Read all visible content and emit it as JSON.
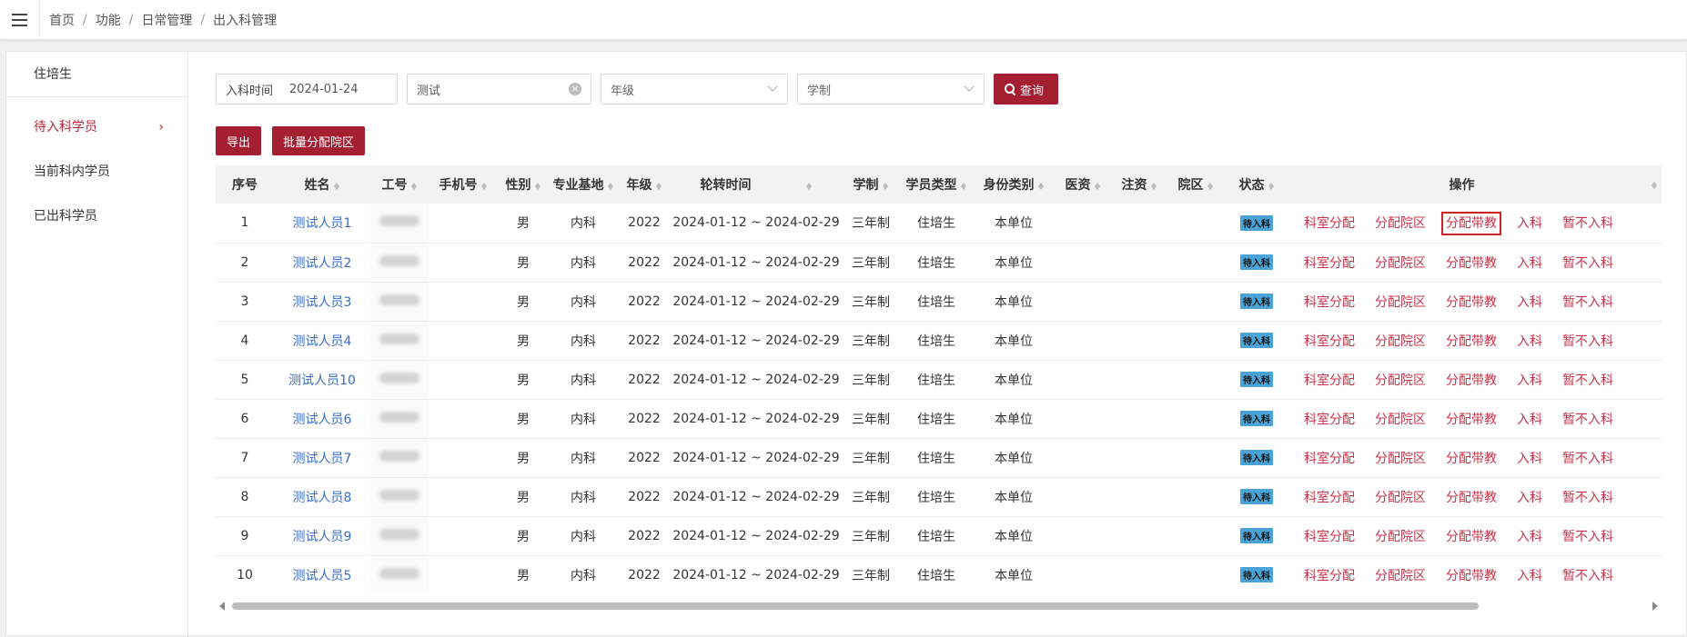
{
  "colors": {
    "accent": "#a51f32",
    "link": "#3a6cc4",
    "op_link": "#c7344a",
    "badge": "#4aa3d6"
  },
  "topbar": {
    "menu_icon": "hamburger-icon",
    "breadcrumb": [
      "首页",
      "功能",
      "日常管理",
      "出入科管理"
    ],
    "separator": "/"
  },
  "sidebar": {
    "title": "住培生",
    "items": [
      {
        "label": "待入科学员",
        "active": true,
        "chevron": "›"
      },
      {
        "label": "当前科内学员"
      },
      {
        "label": "已出科学员"
      }
    ]
  },
  "filters": {
    "date_label": "入科时间",
    "date_value": "2024-01-24",
    "name_value": "测试",
    "clear_icon": "×",
    "grade_placeholder": "年级",
    "system_placeholder": "学制",
    "query_label": "查询"
  },
  "actions": {
    "export_label": "导出",
    "batch_label": "批量分配院区"
  },
  "table": {
    "headers": [
      "序号",
      "姓名",
      "工号",
      "手机号",
      "性别",
      "专业基地",
      "年级",
      "轮转时间",
      "学制",
      "学员类型",
      "身份类别",
      "医资",
      "注资",
      "院区",
      "状态",
      "操作"
    ],
    "rows": [
      {
        "no": "1",
        "name": "测试人员1",
        "gender": "男",
        "base": "内科",
        "grade": "2022",
        "period": "2024-01-12 ~ 2024-02-29",
        "system": "三年制",
        "type": "住培生",
        "identity": "本单位",
        "status": "待入科"
      },
      {
        "no": "2",
        "name": "测试人员2",
        "gender": "男",
        "base": "内科",
        "grade": "2022",
        "period": "2024-01-12 ~ 2024-02-29",
        "system": "三年制",
        "type": "住培生",
        "identity": "本单位",
        "status": "待入科"
      },
      {
        "no": "3",
        "name": "测试人员3",
        "gender": "男",
        "base": "内科",
        "grade": "2022",
        "period": "2024-01-12 ~ 2024-02-29",
        "system": "三年制",
        "type": "住培生",
        "identity": "本单位",
        "status": "待入科"
      },
      {
        "no": "4",
        "name": "测试人员4",
        "gender": "男",
        "base": "内科",
        "grade": "2022",
        "period": "2024-01-12 ~ 2024-02-29",
        "system": "三年制",
        "type": "住培生",
        "identity": "本单位",
        "status": "待入科"
      },
      {
        "no": "5",
        "name": "测试人员10",
        "gender": "男",
        "base": "内科",
        "grade": "2022",
        "period": "2024-01-12 ~ 2024-02-29",
        "system": "三年制",
        "type": "住培生",
        "identity": "本单位",
        "status": "待入科"
      },
      {
        "no": "6",
        "name": "测试人员6",
        "gender": "男",
        "base": "内科",
        "grade": "2022",
        "period": "2024-01-12 ~ 2024-02-29",
        "system": "三年制",
        "type": "住培生",
        "identity": "本单位",
        "status": "待入科"
      },
      {
        "no": "7",
        "name": "测试人员7",
        "gender": "男",
        "base": "内科",
        "grade": "2022",
        "period": "2024-01-12 ~ 2024-02-29",
        "system": "三年制",
        "type": "住培生",
        "identity": "本单位",
        "status": "待入科"
      },
      {
        "no": "8",
        "name": "测试人员8",
        "gender": "男",
        "base": "内科",
        "grade": "2022",
        "period": "2024-01-12 ~ 2024-02-29",
        "system": "三年制",
        "type": "住培生",
        "identity": "本单位",
        "status": "待入科"
      },
      {
        "no": "9",
        "name": "测试人员9",
        "gender": "男",
        "base": "内科",
        "grade": "2022",
        "period": "2024-01-12 ~ 2024-02-29",
        "system": "三年制",
        "type": "住培生",
        "identity": "本单位",
        "status": "待入科"
      },
      {
        "no": "10",
        "name": "测试人员5",
        "gender": "男",
        "base": "内科",
        "grade": "2022",
        "period": "2024-01-12 ~ 2024-02-29",
        "system": "三年制",
        "type": "住培生",
        "identity": "本单位",
        "status": "待入科"
      }
    ],
    "operations": [
      "科室分配",
      "分配院区",
      "分配带教",
      "入科",
      "暂不入科"
    ]
  }
}
